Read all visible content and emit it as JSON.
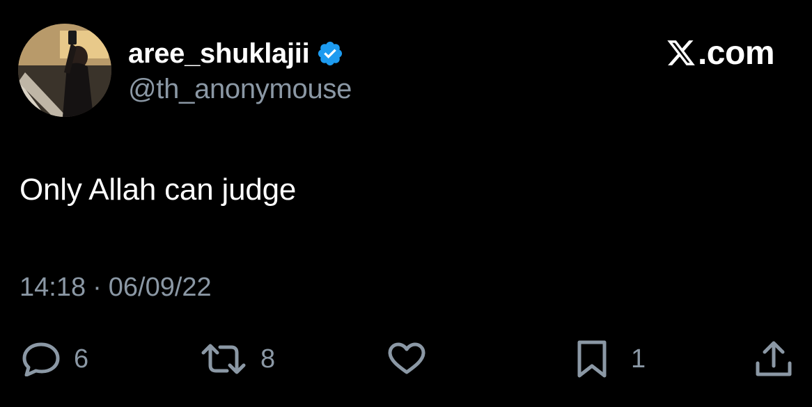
{
  "author": {
    "display_name": "aree_shuklajii",
    "handle": "@th_anonymouse",
    "verified": true
  },
  "brand": {
    "logo_icon": "x-logo-icon",
    "domain_text": ".com"
  },
  "tweet": {
    "text": "Only Allah can judge",
    "time": "14:18",
    "separator": "·",
    "date": "06/09/22"
  },
  "actions": {
    "reply": {
      "icon": "reply-icon",
      "count": "6"
    },
    "retweet": {
      "icon": "retweet-icon",
      "count": "8"
    },
    "like": {
      "icon": "heart-icon"
    },
    "bookmark": {
      "icon": "bookmark-icon",
      "count": "1"
    },
    "share": {
      "icon": "share-icon"
    }
  },
  "colors": {
    "background": "#000000",
    "primary_text": "#ffffff",
    "secondary_text": "#8b98a5",
    "verified_badge": "#1d9bf0"
  }
}
